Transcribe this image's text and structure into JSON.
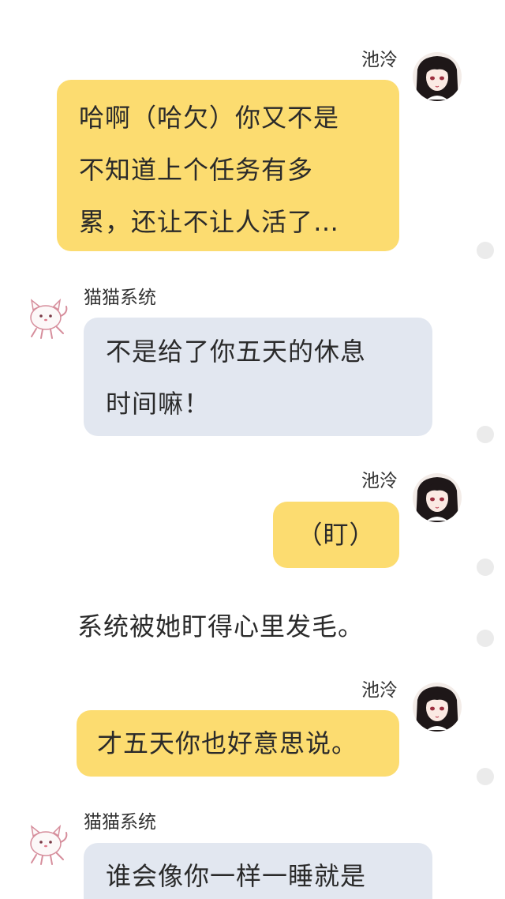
{
  "characters": {
    "chi_ling": "池泠",
    "cat_system": "猫猫系统"
  },
  "messages": [
    {
      "speaker": "池泠",
      "side": "right",
      "lines": [
        "哈啊（哈欠）你又不是",
        "不知道上个任务有多",
        "累，还让不让人活了…"
      ]
    },
    {
      "speaker": "猫猫系统",
      "side": "left",
      "lines": [
        "不是给了你五天的休息",
        "时间嘛！"
      ]
    },
    {
      "speaker": "池泠",
      "side": "right",
      "lines": [
        "（盯）"
      ]
    },
    {
      "narration": "系统被她盯得心里发毛。"
    },
    {
      "speaker": "池泠",
      "side": "right",
      "lines": [
        "才五天你也好意思说。"
      ]
    },
    {
      "speaker": "猫猫系统",
      "side": "left",
      "lines": [
        "谁会像你一样一睡就是"
      ]
    }
  ],
  "colors": {
    "yellow_bubble": "#fcdc70",
    "grey_bubble": "#e2e7f0",
    "background": "#ffffff"
  },
  "icons": {
    "chi_ling_avatar": "girl-portrait-avatar",
    "cat_avatar": "cat-sticker-avatar"
  }
}
